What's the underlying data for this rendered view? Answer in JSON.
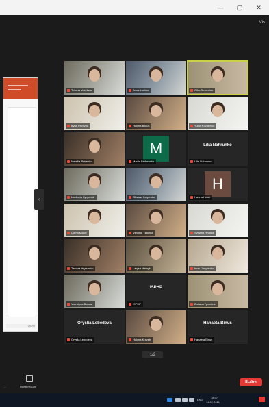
{
  "window": {
    "minimize_glyph": "—",
    "maximize_glyph": "▢",
    "close_glyph": "✕"
  },
  "header": {
    "view_label": "Vis"
  },
  "share": {
    "footer_text": "100%",
    "toggle_glyph": "‹"
  },
  "gallery": [
    {
      "name": "Tetiana Vasylivna"
    },
    {
      "name": "Anna Luchko"
    },
    {
      "name": "Olha Semeniuk"
    },
    {
      "name": "Iryna Pavlivna"
    },
    {
      "name": "Halyna Bilous"
    },
    {
      "name": "Yuliia Kovalenko"
    },
    {
      "name": "Nataliia Petrenko"
    },
    {
      "name": "Mariia Fedorenko",
      "letter": "M"
    },
    {
      "name": "Lilia Nahrunko",
      "label": "Lilia Nahrunko"
    },
    {
      "name": "Liudmyla Kyrychuk"
    },
    {
      "name": "Oksana Karpenko"
    },
    {
      "name": "Hanna Holub",
      "letter": "H"
    },
    {
      "name": "Olena Moroz"
    },
    {
      "name": "Viktoriia Tkachuk"
    },
    {
      "name": "Svitlana Hnatiuk"
    },
    {
      "name": "Tamara Hrytsenko"
    },
    {
      "name": "Larysa Melnyk"
    },
    {
      "name": "Inna Danylenko"
    },
    {
      "name": "Valentyna Bondar"
    },
    {
      "name": "ISPHP",
      "label": "ISPHP"
    },
    {
      "name": "Zoriana Tymchuk"
    },
    {
      "name": "Oryslia Lebedeva",
      "label": "Oryslia Lebedeva"
    },
    {
      "name": "Halyna Kravets"
    },
    {
      "name": "Hanaeta Binus",
      "label": "Hanaeta Binus"
    }
  ],
  "page_indicator": "1/2",
  "toolbar": {
    "left_label": "...",
    "present_label": "Презентация",
    "end_label": "Выйти"
  },
  "taskbar": {
    "time": "18:37",
    "date": "14.02.2021",
    "lang": "ENG"
  }
}
